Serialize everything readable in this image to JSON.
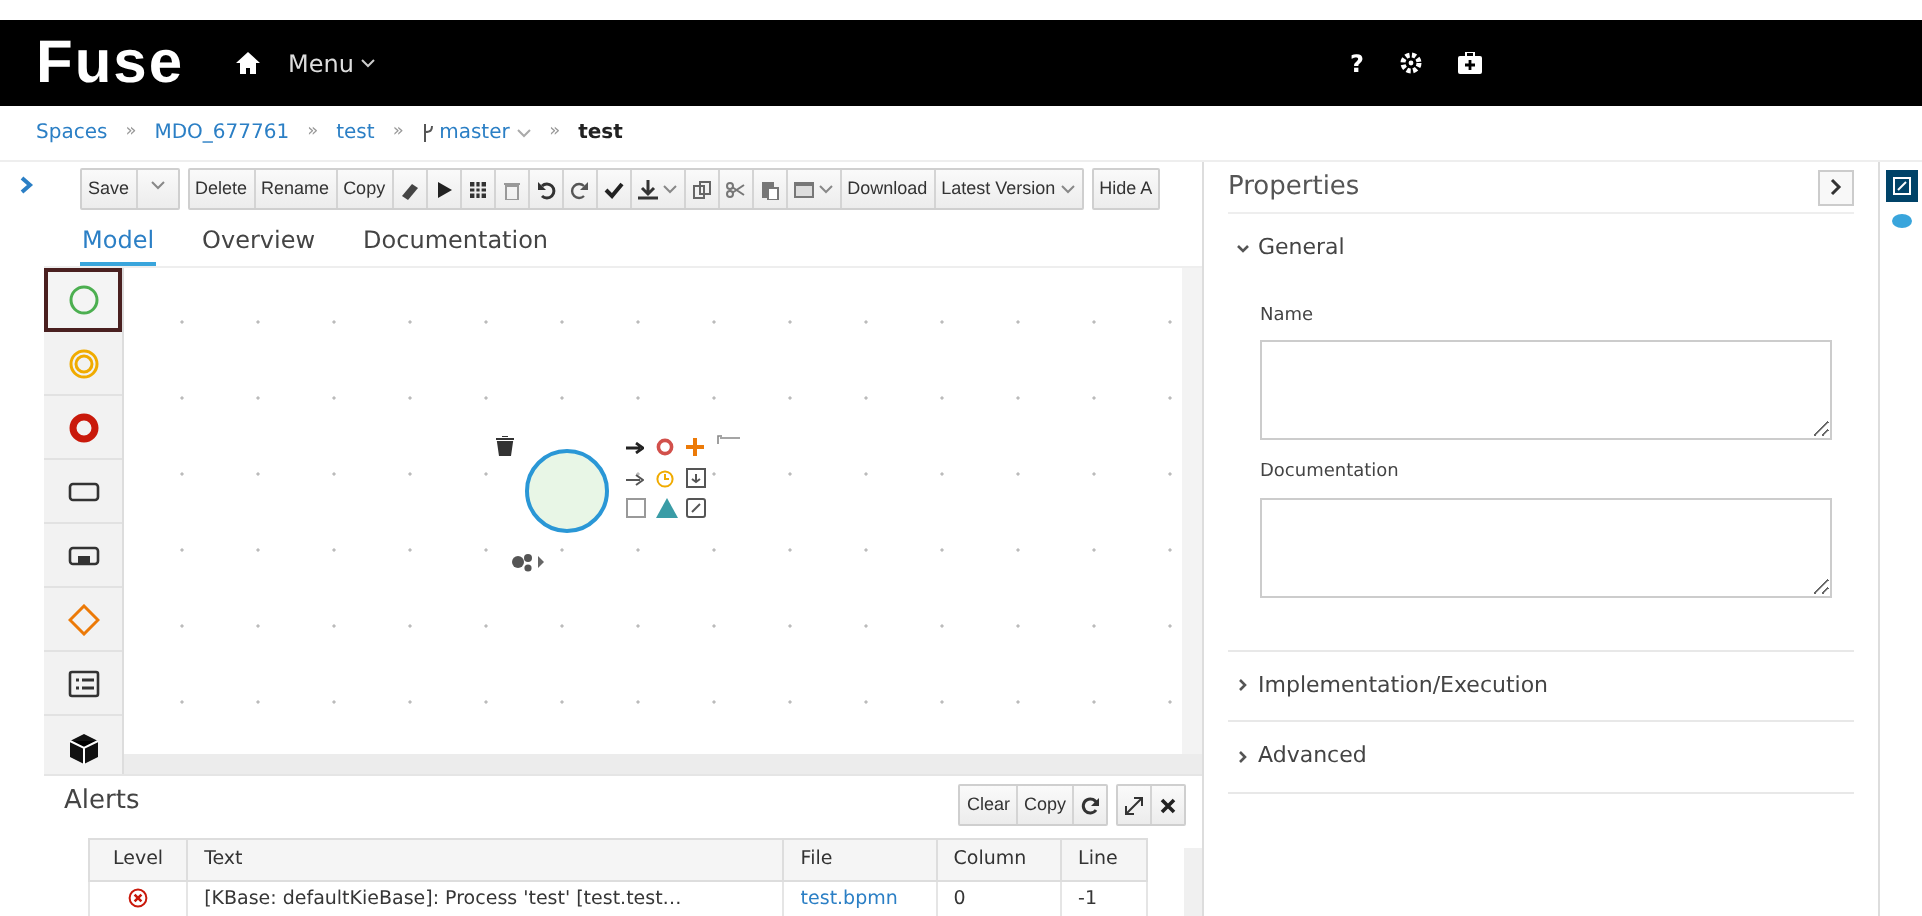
{
  "header": {
    "logo": "Fuse",
    "menu": "Menu",
    "help": "?"
  },
  "breadcrumb": [
    {
      "label": "Spaces",
      "kind": "link"
    },
    {
      "label": "»",
      "kind": "separator"
    },
    {
      "label": "MDO_677761",
      "kind": "link"
    },
    {
      "label": "»",
      "kind": "separator"
    },
    {
      "label": "test",
      "kind": "link"
    },
    {
      "label": "»",
      "kind": "separator"
    },
    {
      "label": "master",
      "kind": "branch"
    },
    {
      "label": "»",
      "kind": "separator"
    },
    {
      "label": "test",
      "kind": "current"
    }
  ],
  "toolbar": {
    "save": "Save",
    "edit": [
      "Delete",
      "Rename",
      "Copy"
    ],
    "download": "Download",
    "version": "Latest Version",
    "hide": "Hide A"
  },
  "tabs": [
    {
      "label": "Model",
      "selected": true
    },
    {
      "label": "Overview",
      "selected": false
    },
    {
      "label": "Documentation",
      "selected": false
    }
  ],
  "palette": [
    {
      "kind": "start",
      "selected": true
    },
    {
      "kind": "intermediate",
      "selected": false
    },
    {
      "kind": "end",
      "selected": false
    },
    {
      "kind": "task",
      "selected": false
    },
    {
      "kind": "subprocess",
      "selected": false
    },
    {
      "kind": "gateway",
      "selected": false
    },
    {
      "kind": "lane",
      "selected": false
    },
    {
      "kind": "cube",
      "selected": false
    }
  ],
  "alerts": {
    "title": "Alerts",
    "buttons": [
      "Clear",
      "Copy"
    ],
    "columns": [
      "Level",
      "Text",
      "File",
      "Column",
      "Line"
    ],
    "rows": [
      {
        "kind": "error",
        "text": "[KBase: defaultKieBase]: Process 'test' [test.test…",
        "file": "test.bpmn",
        "column": "0",
        "line": "-1"
      }
    ]
  },
  "properties": {
    "title": "Properties",
    "sections": [
      {
        "title": "General",
        "expanded": true,
        "fields": [
          {
            "label": "Name"
          },
          {
            "label": "Documentation"
          }
        ]
      },
      {
        "title": "Implementation/Execution",
        "expanded": false
      },
      {
        "title": "Advanced",
        "expanded": false
      }
    ]
  }
}
